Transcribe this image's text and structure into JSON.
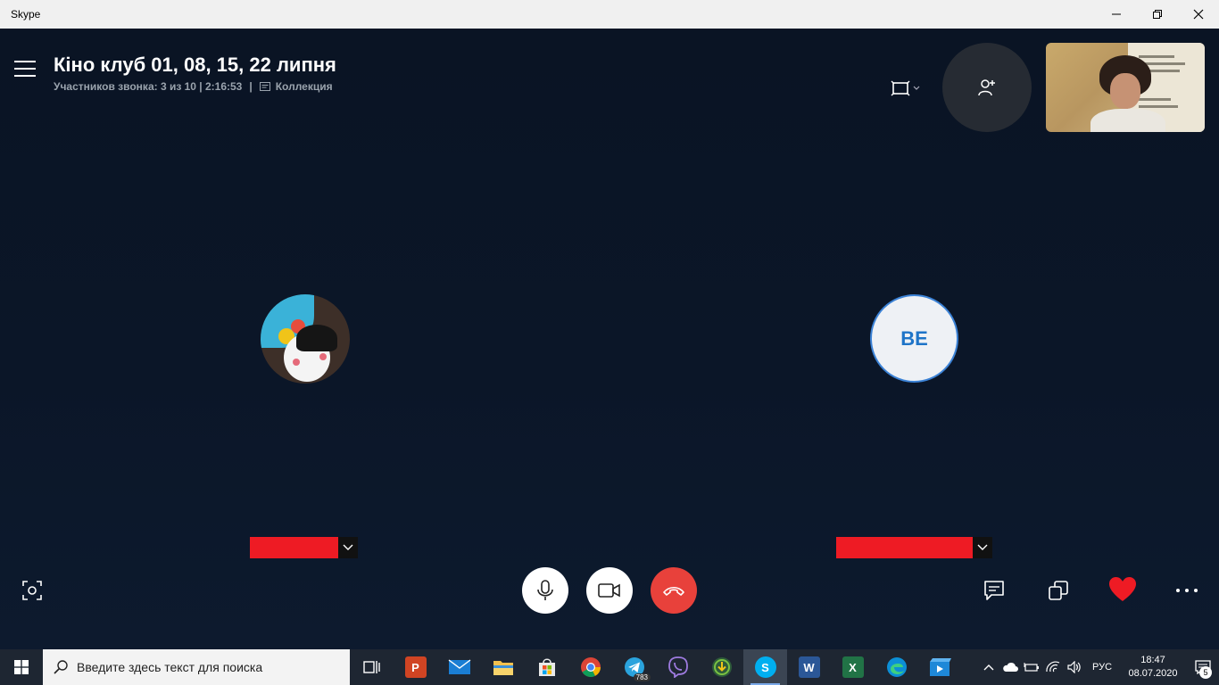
{
  "window": {
    "title": "Skype"
  },
  "call": {
    "title": "Кіно клуб 01, 08, 15, 22 липня",
    "participants_text": "Участников звонка: 3 из 10 | 2:16:53",
    "separator": "|",
    "collection_label": "Коллекция"
  },
  "participants": [
    {
      "avatar": "photo",
      "name_redacted": true
    },
    {
      "initials": "BE",
      "name_redacted": true
    }
  ],
  "colors": {
    "background": "#0a1524",
    "hangup": "#e8413b",
    "redaction": "#ee1b24",
    "accent_blue": "#1e74c8",
    "heart": "#ee1b24"
  },
  "icons": {
    "menu": "hamburger-icon",
    "layout": "layout-icon",
    "add_people": "add-person-icon",
    "snapshot": "camera-snapshot-icon",
    "mic": "microphone-icon",
    "video": "video-camera-icon",
    "hangup": "phone-hangup-icon",
    "chat": "chat-icon",
    "share": "share-screen-icon",
    "react": "heart-icon",
    "more": "more-icon"
  },
  "taskbar": {
    "search_placeholder": "Введите здесь текст для поиска",
    "telegram_badge": "783",
    "language": "РУС",
    "time": "18:47",
    "date": "08.07.2020",
    "notifications": "5"
  }
}
